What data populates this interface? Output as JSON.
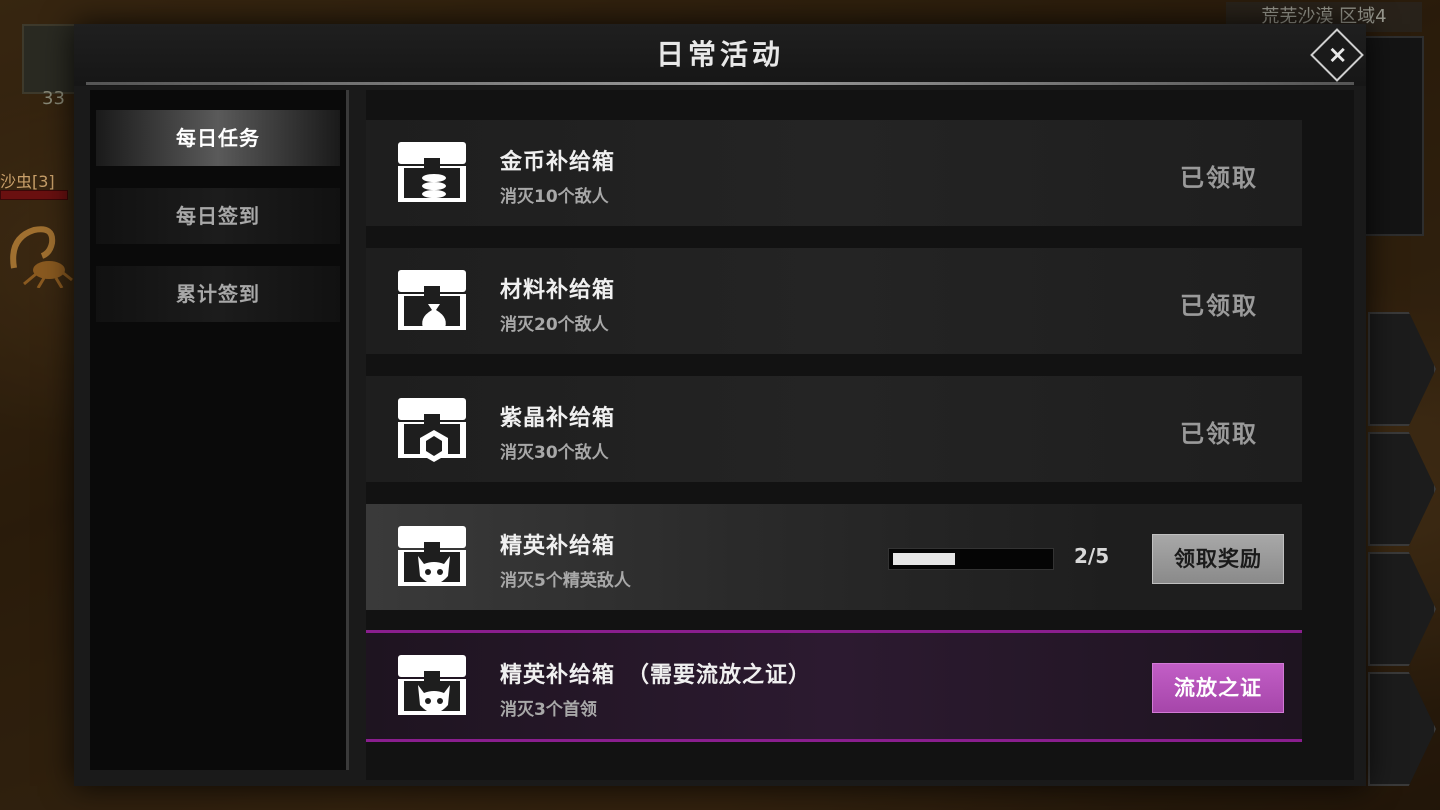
{
  "background": {
    "hud_count": "33",
    "enemy_name": "沙虫[3]",
    "zone": "荒芜沙漠 区域4"
  },
  "dialog": {
    "title": "日常活动",
    "close_icon": "×"
  },
  "sidebar": {
    "tabs": [
      {
        "label": "每日任务",
        "active": true
      },
      {
        "label": "每日签到",
        "active": false
      },
      {
        "label": "累计签到",
        "active": false
      }
    ]
  },
  "tasks": [
    {
      "title": "金币补给箱",
      "desc": "消灭10个敌人",
      "icon": "chest-coins-icon",
      "status": "已领取"
    },
    {
      "title": "材料补给箱",
      "desc": "消灭20个敌人",
      "icon": "chest-bag-icon",
      "status": "已领取"
    },
    {
      "title": "紫晶补给箱",
      "desc": "消灭30个敌人",
      "icon": "chest-gem-icon",
      "status": "已领取"
    },
    {
      "title": "精英补给箱",
      "desc": "消灭5个精英敌人",
      "icon": "chest-skull-icon",
      "progress": 0.4,
      "progress_text": "2/5",
      "button": "领取奖励"
    },
    {
      "title": "精英补给箱　（需要流放之证）",
      "desc": "消灭3个首领",
      "icon": "chest-skull-icon",
      "button": "流放之证"
    }
  ],
  "colors": {
    "accent_purple": "#a646aa",
    "purple_border": "#8a1e8e",
    "button_gray": "#9a9a9a"
  }
}
